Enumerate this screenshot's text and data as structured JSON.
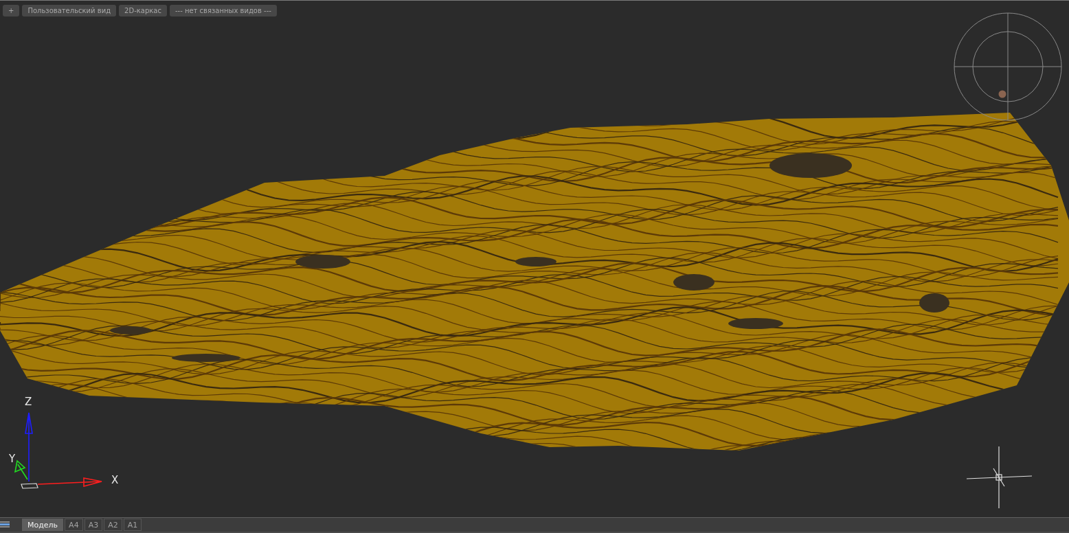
{
  "viewport_controls": [
    {
      "label": "+"
    },
    {
      "label": "Пользовательский вид"
    },
    {
      "label": "2D-каркас"
    },
    {
      "label": "--- нет связанных видов ---"
    }
  ],
  "ucs_axes": [
    {
      "kind": "z",
      "label": "Z"
    },
    {
      "kind": "y",
      "label": "Y"
    },
    {
      "kind": "x",
      "label": "X"
    }
  ],
  "layout_tabs": [
    {
      "label": "Модель",
      "selected": true
    },
    {
      "label": "A4",
      "selected": false
    },
    {
      "label": "A3",
      "selected": false
    },
    {
      "label": "A2",
      "selected": false
    },
    {
      "label": "A1",
      "selected": false
    }
  ]
}
